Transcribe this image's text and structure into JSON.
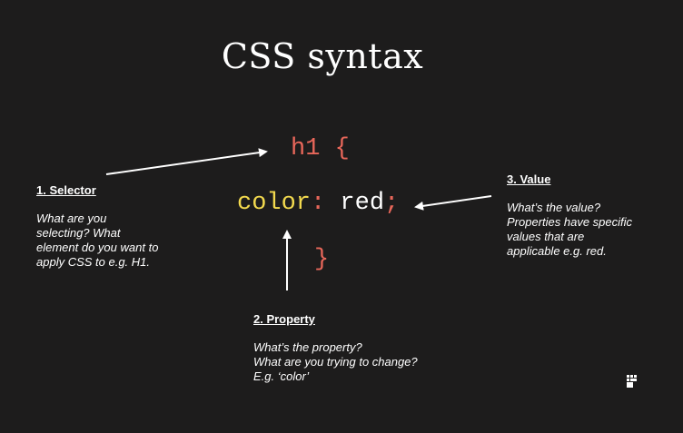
{
  "title": "CSS syntax",
  "code": {
    "selector": "h1",
    "open_brace": "{",
    "property": "color",
    "colon": ":",
    "value": "red",
    "semicolon": ";",
    "close_brace": "}"
  },
  "notes": {
    "selector": {
      "heading": "1. Selector",
      "body": "What are you\nselecting? What\nelement do you want to\napply CSS to e.g. H1."
    },
    "property": {
      "heading": "2. Property",
      "body": "What’s the property?\nWhat are you trying to change?\nE.g. ‘color’"
    },
    "value": {
      "heading": "3. Value",
      "body": "What’s the value?\nProperties have specific\nvalues that are\napplicable e.g. red."
    }
  },
  "colors": {
    "background": "#1d1c1c",
    "selector": "#e8675a",
    "property": "#f2d94e",
    "value": "#ffffff",
    "punctuation": "#e8675a",
    "arrow": "#ffffff"
  },
  "icons": [
    "logo-icon"
  ]
}
